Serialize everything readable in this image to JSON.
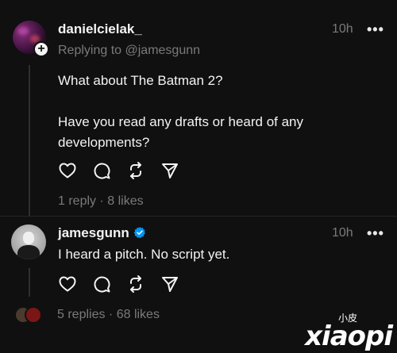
{
  "post1": {
    "username": "danielcielak_",
    "time": "10h",
    "more": "•••",
    "reply_to": "Replying to @jamesgunn",
    "text_line1": "What about The Batman 2?",
    "text_line2": "Have you read any drafts or heard of any",
    "text_line3": "developments?",
    "meta": "1 reply · 8 likes"
  },
  "post2": {
    "username": "jamesgunn",
    "time": "10h",
    "more": "•••",
    "text": "I heard a pitch. No script yet.",
    "meta": "5 replies · 68 likes"
  },
  "watermark": {
    "small": "小皮",
    "big": "xiaopi"
  },
  "colors": {
    "background": "#101010",
    "verified": "#0095f6",
    "secondary_text": "#7a7a7a"
  },
  "icons": [
    "heart-icon",
    "comment-icon",
    "repost-icon",
    "share-icon",
    "verified-icon",
    "plus-icon",
    "more-icon"
  ]
}
